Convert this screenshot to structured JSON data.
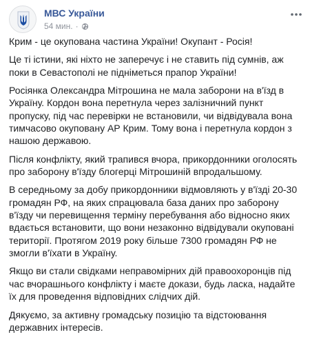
{
  "post": {
    "author": "МВС України",
    "time": "54 мин.",
    "separator": "·",
    "icons": {
      "avatar": "trident-coat-of-arms",
      "privacy": "globe-icon",
      "more": "more-options-icon"
    },
    "colors": {
      "author_link": "#385898",
      "meta": "#90949c",
      "text": "#1c1e21"
    },
    "paragraphs": [
      "Крим - це окупована частина України! Окупант - Росія!",
      "Це ті істини, які ніхто не заперечує і не ставить під сумнів, аж поки в Севастополі не підніметься прапор України!",
      "Росіянка Олександра Мітрошина не мала заборони на в'їзд в Україну. Кордон вона перетнула через залізничний пункт пропуску, під час перевірки не встановили, чи відвідувала вона тимчасово окуповану АР Крим. Тому вона і перетнула кордон з нашою державою.",
      "Після конфлікту, який трапився вчора, прикордонники оголосять про заборону в'їзду блогерці Мітрошиній впродальшому.",
      "В середньому за добу прикордонники відмовляють у в'їзді 20-30 громадян РФ, на яких спрацювала база даних про заборону в'їзду чи перевищення терміну перебування або відносно яких вдається встановити, що вони незаконно відвідували окуповані території. Протягом 2019 року більше 7300 громадян РФ не змогли в'їхати в Україну.",
      "Якщо ви стали свідками неправомірних дій правоохоронців під час вчорашнього конфлікту і маєте докази, будь ласка, надайте їх для проведення відповідних слідчих дій.",
      "Дякуємо, за активну громадську позицію та відстоювання державних інтересів."
    ]
  }
}
